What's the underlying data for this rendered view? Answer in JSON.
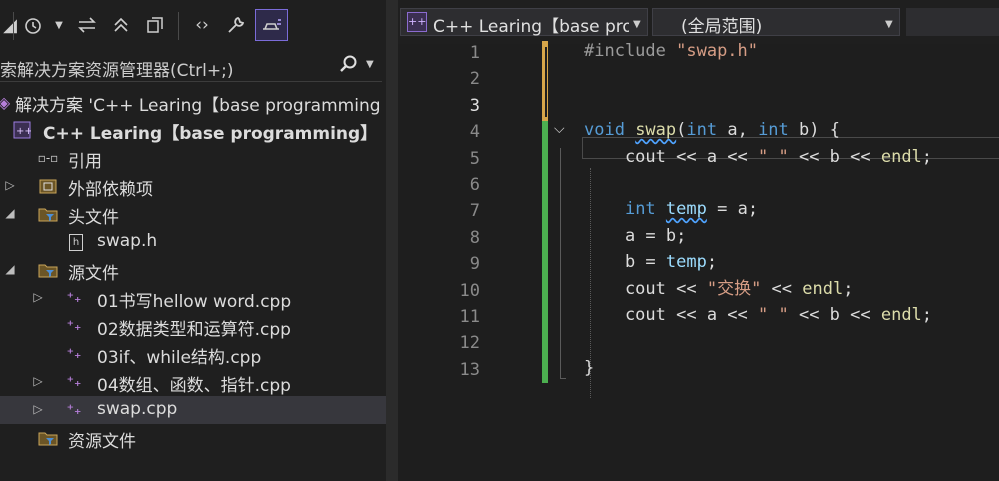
{
  "explorer": {
    "toolbar": {
      "icons": [
        "pending-changes-filter-icon",
        "history-clock-icon",
        "dropdown-icon",
        "sync-icon",
        "collapse-all-icon",
        "switch-views-icon",
        "code-view-icon",
        "properties-wrench-icon",
        "preview-selected-items-icon"
      ]
    },
    "search_placeholder": "索解决方案资源管理器(Ctrl+;)",
    "tree": [
      {
        "label": "解决方案 'C++ Learing【base programming",
        "icon": "solution-icon",
        "expander": "",
        "bold": false
      },
      {
        "label": "C++ Learing【base programming】",
        "icon": "cpp-project-icon",
        "expander": "",
        "bold": true
      },
      {
        "label": "引用",
        "icon": "references-icon",
        "expander": "",
        "bold": false
      },
      {
        "label": "外部依赖项",
        "icon": "external-dependencies-icon",
        "expander": "▷",
        "bold": false
      },
      {
        "label": "头文件",
        "icon": "filter-folder-icon",
        "expander": "◢",
        "bold": false
      },
      {
        "label": "swap.h",
        "icon": "header-file-icon",
        "expander": "",
        "bold": false
      },
      {
        "label": "源文件",
        "icon": "filter-folder-icon",
        "expander": "◢",
        "bold": false
      },
      {
        "label": "01书写hellow word.cpp",
        "icon": "cpp-file-icon",
        "expander": "▷",
        "bold": false
      },
      {
        "label": "02数据类型和运算符.cpp",
        "icon": "cpp-file-icon",
        "expander": "",
        "bold": false
      },
      {
        "label": "03if、while结构.cpp",
        "icon": "cpp-file-icon",
        "expander": "",
        "bold": false
      },
      {
        "label": "04数组、函数、指针.cpp",
        "icon": "cpp-file-icon",
        "expander": "▷",
        "bold": false
      },
      {
        "label": "swap.cpp",
        "icon": "cpp-file-icon",
        "expander": "▷",
        "bold": false,
        "selected": true
      },
      {
        "label": "资源文件",
        "icon": "filter-folder-icon",
        "expander": "",
        "bold": false
      }
    ]
  },
  "editor": {
    "file_dropdown": "C++ Learing【base pro",
    "scope_dropdown": "(全局范围)",
    "current_line": 3,
    "line_numbers": [
      "1",
      "2",
      "3",
      "4",
      "5",
      "6",
      "7",
      "8",
      "9",
      "10",
      "11",
      "12",
      "13"
    ],
    "lines": [
      [
        {
          "t": "#include ",
          "c": "inc"
        },
        {
          "t": "\"swap.h\"",
          "c": "str"
        }
      ],
      [],
      [],
      [
        {
          "t": "void ",
          "c": "kw"
        },
        {
          "t": "swap",
          "c": "fn squig"
        },
        {
          "t": "(",
          "c": "plain"
        },
        {
          "t": "int",
          "c": "kw"
        },
        {
          "t": " a, ",
          "c": "plain"
        },
        {
          "t": "int",
          "c": "kw"
        },
        {
          "t": " b) {",
          "c": "plain"
        }
      ],
      [
        {
          "t": "    cout << a << ",
          "c": "plain"
        },
        {
          "t": "\" \"",
          "c": "str"
        },
        {
          "t": " << b << ",
          "c": "plain"
        },
        {
          "t": "endl",
          "c": "fn"
        },
        {
          "t": ";",
          "c": "plain"
        }
      ],
      [],
      [
        {
          "t": "    ",
          "c": "plain"
        },
        {
          "t": "int",
          "c": "kw"
        },
        {
          "t": " ",
          "c": "plain"
        },
        {
          "t": "temp",
          "c": "var squig"
        },
        {
          "t": " = a;",
          "c": "plain"
        }
      ],
      [
        {
          "t": "    a = b;",
          "c": "plain"
        }
      ],
      [
        {
          "t": "    b = ",
          "c": "plain"
        },
        {
          "t": "temp",
          "c": "var"
        },
        {
          "t": ";",
          "c": "plain"
        }
      ],
      [
        {
          "t": "    cout << ",
          "c": "plain"
        },
        {
          "t": "\"交换\"",
          "c": "str"
        },
        {
          "t": " << ",
          "c": "plain"
        },
        {
          "t": "endl",
          "c": "fn"
        },
        {
          "t": ";",
          "c": "plain"
        }
      ],
      [
        {
          "t": "    cout << a << ",
          "c": "plain"
        },
        {
          "t": "\" \"",
          "c": "str"
        },
        {
          "t": " << b << ",
          "c": "plain"
        },
        {
          "t": "endl",
          "c": "fn"
        },
        {
          "t": ";",
          "c": "plain"
        }
      ],
      [],
      [
        {
          "t": "}",
          "c": "plain"
        }
      ]
    ],
    "colors": {
      "change_saved": "#4caf50",
      "change_unsaved": "#d7a64a",
      "selection_accent": "#7b6cd9"
    }
  }
}
